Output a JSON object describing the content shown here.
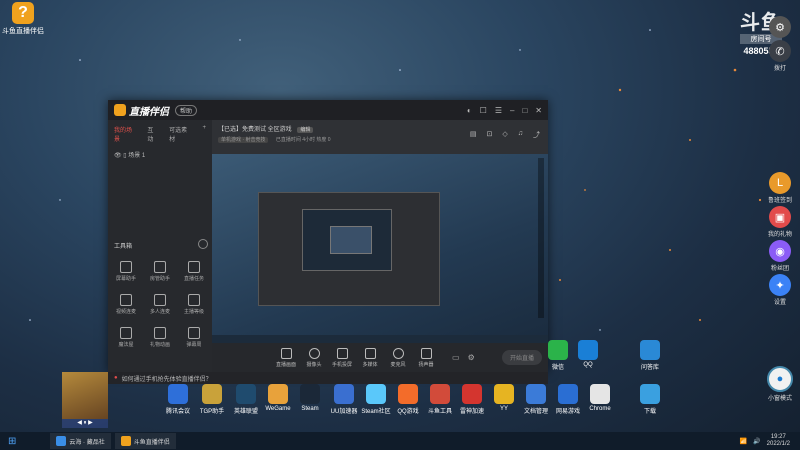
{
  "desktop": {
    "top_icon_label": "斗鱼直播伴侣",
    "watermark": {
      "logo": "斗鱼",
      "sub": "房间号",
      "room": "4880556"
    },
    "apps": [
      {
        "label": "微信",
        "color": "#2bb34a"
      },
      {
        "label": "QQ",
        "color": "#1a7fd6"
      },
      {
        "label": "问答库",
        "color": "#2a89d6"
      },
      {
        "label": "腾讯会议",
        "color": "#2e6fd9"
      },
      {
        "label": "TGP助手",
        "color": "#c9a23a"
      },
      {
        "label": "英雄联盟",
        "color": "#1f4b6e"
      },
      {
        "label": "WeGame",
        "color": "#e8a23b"
      },
      {
        "label": "Steam",
        "color": "#1b2838"
      },
      {
        "label": "UU加速器",
        "color": "#3a6fd0"
      },
      {
        "label": "Steam社区",
        "color": "#5ac8fa"
      },
      {
        "label": "QQ游戏",
        "color": "#f36c2a"
      },
      {
        "label": "斗鱼工具",
        "color": "#d24b3a"
      },
      {
        "label": "雷神加速",
        "color": "#d4352f"
      },
      {
        "label": "YY",
        "color": "#e6b422"
      },
      {
        "label": "文档管理",
        "color": "#3b7bd8"
      },
      {
        "label": "网易游戏",
        "color": "#2a6ed3"
      },
      {
        "label": "Chrome",
        "color": "#e5e5e5"
      },
      {
        "label": "下载",
        "color": "#3aa0e0"
      }
    ]
  },
  "sidebar_right": {
    "items": [
      {
        "label": "",
        "color": "#555"
      },
      {
        "label": "拨打",
        "color": "#3a3f47"
      },
      {
        "label": "鲁班签到",
        "color": "#e99a2b"
      },
      {
        "label": "我的礼物",
        "color": "#e24b4b"
      },
      {
        "label": "粉丝团",
        "color": "#8b5cf6"
      },
      {
        "label": "设置",
        "color": "#3b82f6"
      },
      {
        "label": "小窗模式",
        "color": "#f1f1f1"
      }
    ]
  },
  "window": {
    "brand": "直播伴侣",
    "pill": "帮助",
    "tabs": [
      "我的场景",
      "互动",
      "可选素材"
    ],
    "scene": "场景 1",
    "tools_title": "工具箱",
    "tools": [
      {
        "label": "屏幕助手"
      },
      {
        "label": "房管助手"
      },
      {
        "label": "直播任务"
      },
      {
        "label": "视频连麦"
      },
      {
        "label": "多人连麦"
      },
      {
        "label": "主播等级"
      },
      {
        "label": "魔法屋"
      },
      {
        "label": "礼物动画"
      },
      {
        "label": "弹幕周"
      }
    ],
    "room_title": "【已选】免费测试 全区游戏",
    "room_tag": "编辑",
    "room_meta": "单机游戏 · 射击竞技",
    "room_stats": "已直播时间 4小时  热度 0",
    "bottom_buttons": [
      "直播画面",
      "摄像头",
      "手机投屏",
      "多媒体",
      "麦克风",
      "扬声器"
    ],
    "go_live": "开始直播",
    "notice": "如何通过手机抢先体验直播伴侣？"
  },
  "thumb": {
    "controls": "◀ ⏸ ▶"
  },
  "taskbar": {
    "tasks": [
      {
        "label": "云海 · 藏品社",
        "color": "#3a8ee6"
      },
      {
        "label": "斗鱼直播伴侣",
        "color": "#f0a21e"
      }
    ],
    "time": "19:27",
    "date": "2022/1/2"
  }
}
